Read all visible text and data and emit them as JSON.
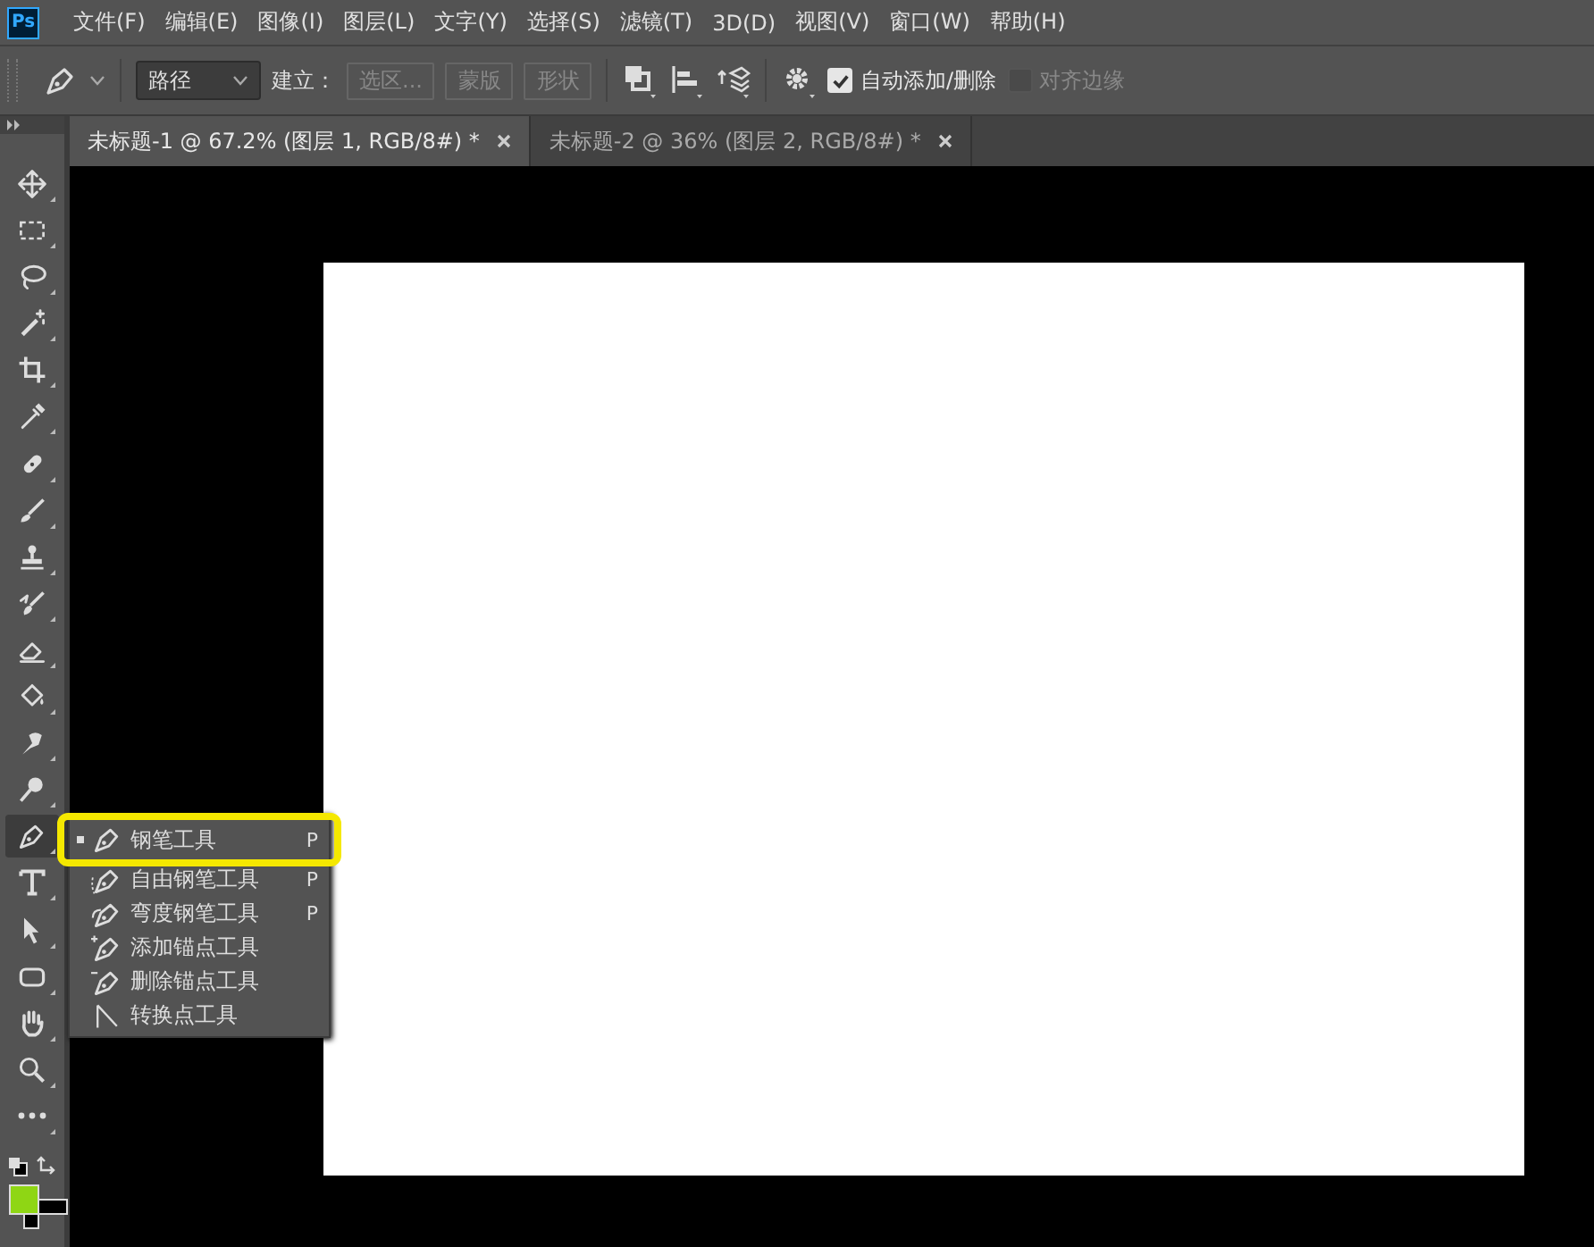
{
  "app_logo": "Ps",
  "menu": [
    "文件(F)",
    "编辑(E)",
    "图像(I)",
    "图层(L)",
    "文字(Y)",
    "选择(S)",
    "滤镜(T)",
    "3D(D)",
    "视图(V)",
    "窗口(W)",
    "帮助(H)"
  ],
  "options_bar": {
    "mode": "路径",
    "make_label": "建立：",
    "buttons": [
      {
        "label": "选区...",
        "disabled": true
      },
      {
        "label": "蒙版",
        "disabled": true
      },
      {
        "label": "形状",
        "disabled": true
      }
    ],
    "checkboxes": [
      {
        "label": "自动添加/删除",
        "checked": true,
        "disabled": false
      },
      {
        "label": "对齐边缘",
        "checked": false,
        "disabled": true
      }
    ]
  },
  "tabs": [
    {
      "label": "未标题-1 @ 67.2% (图层 1, RGB/8#) *",
      "selected": true
    },
    {
      "label": "未标题-2 @ 36% (图层 2, RGB/8#) *",
      "selected": false
    }
  ],
  "tools": [
    {
      "kind": "move",
      "selected": false
    },
    {
      "kind": "marquee",
      "selected": false
    },
    {
      "kind": "lasso",
      "selected": false
    },
    {
      "kind": "wand",
      "selected": false
    },
    {
      "kind": "crop",
      "selected": false
    },
    {
      "kind": "eyedropper",
      "selected": false
    },
    {
      "kind": "bandage",
      "selected": false
    },
    {
      "kind": "brush",
      "selected": false
    },
    {
      "kind": "stamp",
      "selected": false
    },
    {
      "kind": "history",
      "selected": false
    },
    {
      "kind": "eraser",
      "selected": false
    },
    {
      "kind": "bucket",
      "selected": false
    },
    {
      "kind": "smudge",
      "selected": false
    },
    {
      "kind": "dodge",
      "selected": false
    },
    {
      "kind": "pen",
      "selected": true
    },
    {
      "kind": "type",
      "selected": false
    },
    {
      "kind": "arrow",
      "selected": false
    },
    {
      "kind": "shape",
      "selected": false
    },
    {
      "kind": "hand",
      "selected": false
    },
    {
      "kind": "zoom",
      "selected": false
    },
    {
      "kind": "more",
      "selected": false
    }
  ],
  "swatches": [
    {
      "kind": "foreground",
      "color": "#8fd614"
    },
    {
      "kind": "background",
      "color": "#000000"
    }
  ],
  "flyout": [
    {
      "label": "钢笔工具",
      "shortcut": "P",
      "kind": "pen",
      "selected": true
    },
    {
      "label": "自由钢笔工具",
      "shortcut": "P",
      "kind": "freepen",
      "selected": false
    },
    {
      "label": "弯度钢笔工具",
      "shortcut": "P",
      "kind": "curvepen",
      "selected": false
    },
    {
      "label": "添加锚点工具",
      "kind": "addpen",
      "selected": false
    },
    {
      "label": "删除锚点工具",
      "kind": "delpen",
      "selected": false
    },
    {
      "label": "转换点工具",
      "kind": "convert",
      "selected": false
    }
  ]
}
